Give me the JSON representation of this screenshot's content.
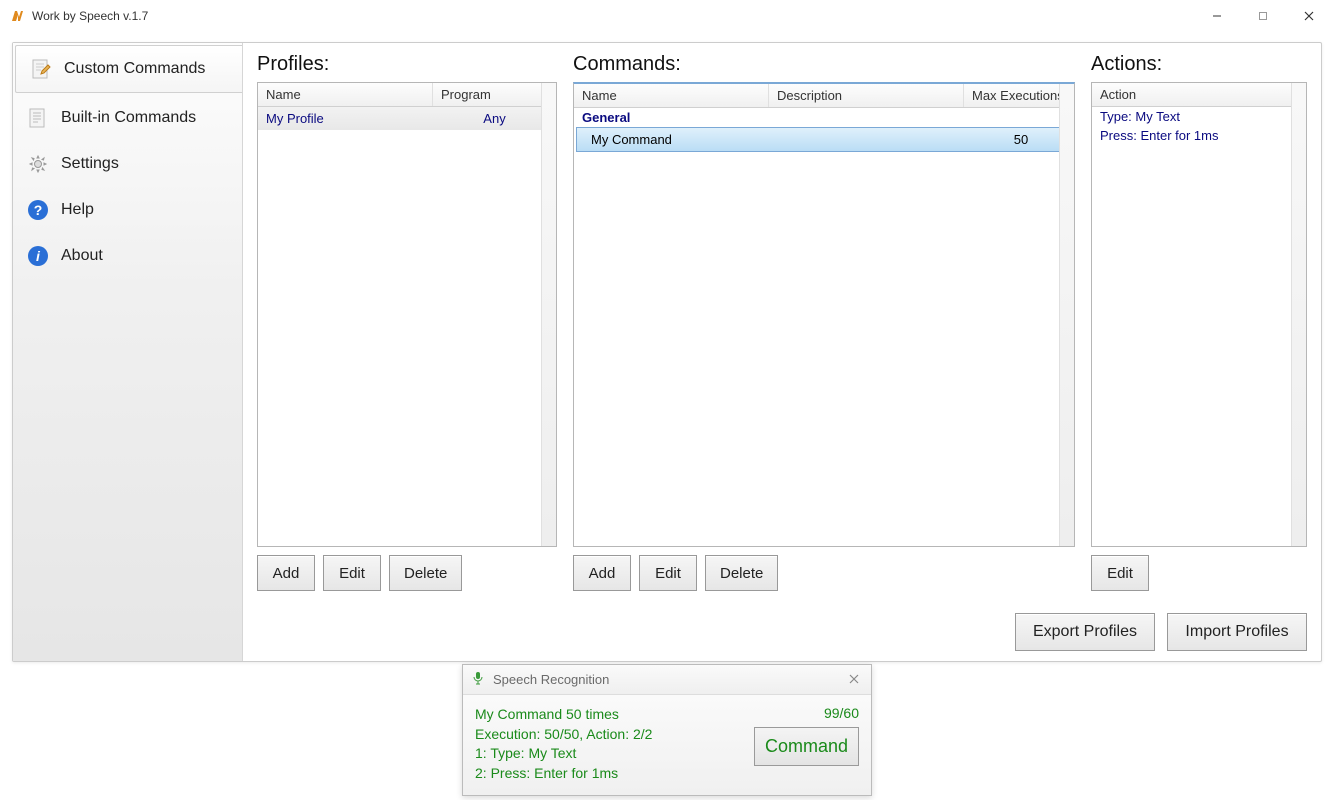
{
  "window": {
    "title": "Work by Speech v.1.7"
  },
  "sidebar": {
    "items": [
      {
        "label": "Custom Commands"
      },
      {
        "label": "Built-in Commands"
      },
      {
        "label": "Settings"
      },
      {
        "label": "Help"
      },
      {
        "label": "About"
      }
    ]
  },
  "profiles": {
    "title": "Profiles:",
    "header_name": "Name",
    "header_program": "Program",
    "rows": [
      {
        "name": "My Profile",
        "program": "Any"
      }
    ],
    "add": "Add",
    "edit": "Edit",
    "delete": "Delete"
  },
  "commands": {
    "title": "Commands:",
    "header_name": "Name",
    "header_desc": "Description",
    "header_max": "Max Executions",
    "group": "General",
    "row_name": "My Command",
    "row_max": "50",
    "add": "Add",
    "edit": "Edit",
    "delete": "Delete"
  },
  "actions": {
    "title": "Actions:",
    "header": "Action",
    "line1": "Type: My Text",
    "line2": "Press: Enter for 1ms",
    "edit": "Edit"
  },
  "bottom": {
    "export": "Export Profiles",
    "import": "Import Profiles"
  },
  "toast": {
    "title": "Speech Recognition",
    "line1": "My Command 50 times",
    "line2": "Execution: 50/50, Action: 2/2",
    "line3": "1: Type: My Text",
    "line4": "2: Press: Enter for 1ms",
    "count": "99/60",
    "button": "Command"
  }
}
